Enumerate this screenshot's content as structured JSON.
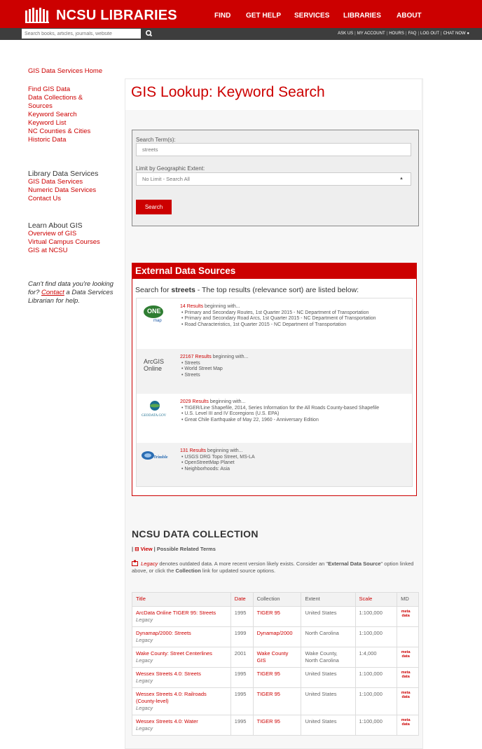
{
  "header": {
    "logo_text": "NCSU LIBRARIES",
    "nav": [
      "FIND",
      "GET HELP",
      "SERVICES",
      "LIBRARIES",
      "ABOUT"
    ],
    "search_placeholder": "Search books, articles, journals, website",
    "utility": [
      "ASK US",
      "MY ACCOUNT",
      "HOURS",
      "FAQ",
      "LOG OUT",
      "CHAT NOW"
    ]
  },
  "sidebar": {
    "home": "GIS Data Services Home",
    "find_heading": "Find GIS Data",
    "find_items": [
      "Data Collections & Sources",
      "Keyword Search",
      "Keyword List",
      "NC Counties & Cities",
      "Historic Data"
    ],
    "library_heading": "Library Data Services",
    "library_items": [
      "GIS Data Services",
      "Numeric Data Services",
      "Contact Us"
    ],
    "learn_heading": "Learn About GIS",
    "learn_items": [
      "Overview of GIS",
      "Virtual Campus Courses",
      "GIS at NCSU"
    ],
    "note_pre": "Can't find data you're looking for?",
    "note_link": "Contact",
    "note_post": "a Data Services Librarian for help."
  },
  "main": {
    "title": "GIS Lookup: Keyword Search",
    "form": {
      "term_label": "Search Term(s):",
      "term_value": "streets",
      "extent_label": "Limit by Geographic Extent:",
      "extent_value": "No Limit - Search All",
      "submit_label": "Search"
    },
    "external": {
      "heading": "External Data Sources",
      "lead_pre": "Search for",
      "lead_term": "streets",
      "lead_post": "- The top results (relevance sort) are listed below:",
      "results": [
        {
          "logo": "nc-onemap-logo",
          "count": "14 Results",
          "suffix": "beginning with...",
          "items": [
            "Primary and Secondary Routes, 1st Quarter 2015 - NC Department of Transportation",
            "Primary and Secondary Road Arcs, 1st Quarter 2015 - NC Department of Transportation",
            "Road Characteristics, 1st Quarter 2015 - NC Department of Transportation"
          ]
        },
        {
          "logo": "arcgis-online-logo",
          "count": "22167 Results",
          "suffix": "beginning with...",
          "items": [
            "Streets",
            "World Street Map",
            "Streets"
          ]
        },
        {
          "logo": "geodata-logo",
          "count": "2029 Results",
          "suffix": "beginning with...",
          "items": [
            "TIGER/Line Shapefile, 2014, Series Information for the All Roads County-based Shapefile",
            "U.S. Level III and IV Ecoregions (U.S. EPA)",
            "Great Chile Earthquake of May 22, 1960 - Anniversary Edition"
          ]
        },
        {
          "logo": "trimble-logo",
          "count": "131 Results",
          "suffix": "beginning with...",
          "items": [
            "USGS DRG Topo Street, MS-LA",
            "OpenStreetMap Planet",
            "Neighborhoods: Asia"
          ]
        }
      ]
    },
    "collection": {
      "heading": "NCSU DATA COLLECTION",
      "view_label": "View",
      "related_label": "| Possible Related Terms",
      "legacy_word": "Legacy",
      "legacy_pre": "denotes outdated data. A more recent version likely exists. Consider an \"",
      "legacy_bold": "External Data Source",
      "legacy_mid": "\" option linked above, or click the",
      "legacy_bold2": "Collection",
      "legacy_post": "link for updated source options.",
      "columns": [
        "Title",
        "Date",
        "Collection",
        "Extent",
        "Scale",
        "MD"
      ],
      "rows": [
        {
          "title": "ArcData Online TIGER 95: Streets",
          "legacy": "Legacy",
          "date": "1995",
          "collection": "TIGER 95",
          "extent": "United States",
          "scale": "1:100,000",
          "md": "meta data"
        },
        {
          "title": "Dynamap/2000: Streets",
          "legacy": "Legacy",
          "date": "1999",
          "collection": "Dynamap/2000",
          "extent": "North Carolina",
          "scale": "1:100,000",
          "md": ""
        },
        {
          "title": "Wake County: Street Centerlines",
          "legacy": "Legacy",
          "date": "2001",
          "collection": "Wake County GIS",
          "extent": "Wake County, North Carolina",
          "scale": "1:4,000",
          "md": "meta data"
        },
        {
          "title": "Wessex Streets 4.0: Streets",
          "legacy": "Legacy",
          "date": "1995",
          "collection": "TIGER 95",
          "extent": "United States",
          "scale": "1:100,000",
          "md": "meta data"
        },
        {
          "title": "Wessex Streets 4.0: Railroads (County-level)",
          "legacy": "Legacy",
          "date": "1995",
          "collection": "TIGER 95",
          "extent": "United States",
          "scale": "1:100,000",
          "md": "meta data"
        },
        {
          "title": "Wessex Streets 4.0: Water",
          "legacy": "Legacy",
          "date": "1995",
          "collection": "TIGER 95",
          "extent": "United States",
          "scale": "1:100,000",
          "md": "meta data"
        }
      ]
    }
  }
}
